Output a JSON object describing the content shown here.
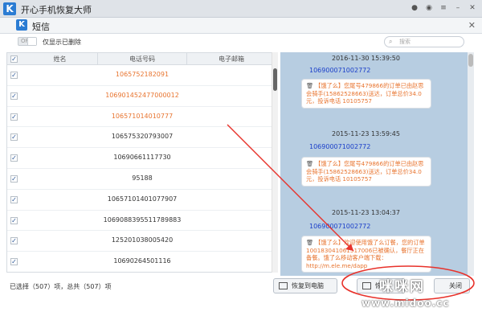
{
  "app": {
    "title": "开心手机恢复大师",
    "logo_letter": "K"
  },
  "titlebar_icons": [
    "wechat-icon",
    "chat-icon",
    "menu-icon",
    "minimize-icon",
    "close-icon"
  ],
  "window": {
    "title": "短信",
    "logo_letter": "K"
  },
  "toolbar": {
    "toggle_label": "OFF",
    "only_deleted_label": "仅显示已删除",
    "search_placeholder": "搜索"
  },
  "table": {
    "headers": [
      "姓名",
      "电话号码",
      "电子邮箱"
    ],
    "rows": [
      {
        "checked": true,
        "phone": "1065752182091",
        "orange": true
      },
      {
        "checked": true,
        "phone": "106901452477000012",
        "orange": true
      },
      {
        "checked": true,
        "phone": "106571014010777",
        "orange": true
      },
      {
        "checked": true,
        "phone": "106575320793007",
        "orange": false
      },
      {
        "checked": true,
        "phone": "10690661117730",
        "orange": false
      },
      {
        "checked": true,
        "phone": "95188",
        "orange": false
      },
      {
        "checked": true,
        "phone": "10657101401077907",
        "orange": false
      },
      {
        "checked": true,
        "phone": "1069088395511789883",
        "orange": false
      },
      {
        "checked": true,
        "phone": "125201038005420",
        "orange": false
      },
      {
        "checked": true,
        "phone": "10690264501116",
        "orange": false
      }
    ]
  },
  "status": {
    "text": "已选择（507）项，总共（507）项"
  },
  "messages": [
    {
      "date": "2016-11-30 15:39:50",
      "sender": "1069000710027​72",
      "text": "【饿了么】您尾号479866的订单已由赵思会骑手(15862528663)送达，订单总价34.0元，投诉电话 10105757"
    },
    {
      "date": "2015-11-23 13:59:45",
      "sender": "1069000710027​72",
      "text": "【饿了么】您尾号479866的订单已由赵思会骑手(15862528663)送达，订单总价34.0元，投诉电话 10105757"
    },
    {
      "date": "2015-11-23 13:04:37",
      "sender": "1069000710027​72",
      "text": "【饿了么】欢迎使用饿了么订餐，您的订单10018304106151​7006已被确认，餐厅正在备餐。饿了么移动客户端下载：http://m.ele.me/dapp"
    }
  ],
  "buttons": {
    "restore_to_pc": "恢复到电脑",
    "restore": "恢",
    "close": "关闭"
  },
  "watermark": {
    "brand": "咪咪网",
    "url": "www.midoo.cc"
  },
  "colors": {
    "accent_blue": "#2b7cd3",
    "orange_text": "#e8742f",
    "sender_blue": "#1a3ec9",
    "arrow_red": "#e8322b"
  }
}
